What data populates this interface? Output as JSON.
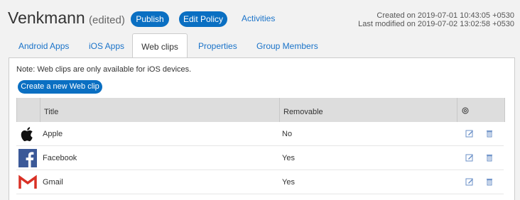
{
  "header": {
    "title": "Venkmann",
    "edited": "(edited)",
    "publish_label": "Publish",
    "edit_policy_label": "Edit Policy",
    "activities_label": "Activities",
    "created": "Created on 2019-07-01 10:43:05 +0530",
    "modified": "Last modified on 2019-07-02 13:02:58 +0530"
  },
  "tabs": [
    {
      "label": "Android Apps"
    },
    {
      "label": "iOS Apps"
    },
    {
      "label": "Web clips"
    },
    {
      "label": "Properties"
    },
    {
      "label": "Group Members"
    }
  ],
  "panel": {
    "note": "Note: Web clips are only available for iOS devices.",
    "create_label": "Create a new Web clip"
  },
  "table": {
    "columns": [
      "Title",
      "Removable"
    ],
    "rows": [
      {
        "title": "Apple",
        "removable": "No",
        "icon": "apple-logo-icon"
      },
      {
        "title": "Facebook",
        "removable": "Yes",
        "icon": "facebook-logo-icon"
      },
      {
        "title": "Gmail",
        "removable": "Yes",
        "icon": "gmail-logo-icon"
      }
    ]
  },
  "colors": {
    "accent": "#0a6fc2",
    "link": "#1a73c9",
    "facebook": "#3b5998",
    "gmail": "#d93025"
  }
}
